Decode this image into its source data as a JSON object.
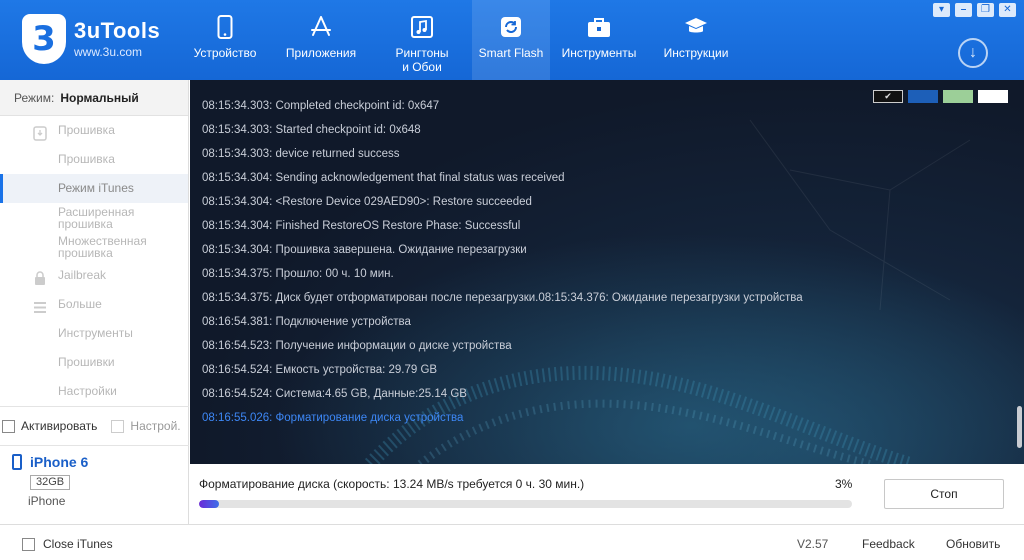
{
  "brand": {
    "logo_glyph": "3",
    "name": "3uTools",
    "url": "www.3u.com"
  },
  "nav": [
    {
      "label": "Устройство",
      "icon": "phone-icon",
      "active": false
    },
    {
      "label": "Приложения",
      "icon": "app-store-icon",
      "active": false
    },
    {
      "label": "Рингтоны\nи Обои",
      "icon": "music-icon",
      "active": false
    },
    {
      "label": "Smart Flash",
      "icon": "refresh-icon",
      "active": true
    },
    {
      "label": "Инструменты",
      "icon": "toolbox-icon",
      "active": false
    },
    {
      "label": "Инструкции",
      "icon": "graduation-cap-icon",
      "active": false
    }
  ],
  "window_controls": [
    "shirt-icon",
    "minimize-icon",
    "restore-icon",
    "close-icon"
  ],
  "sidebar": {
    "mode_label": "Режим:",
    "mode_value": "Нормальный",
    "items": [
      {
        "label": "Прошивка",
        "icon": "firmware-icon",
        "active": false
      },
      {
        "label": "Прошивка",
        "icon": "",
        "active": false
      },
      {
        "label": "Режим iTunes",
        "icon": "",
        "active": true
      },
      {
        "label": "Расширенная прошивка",
        "icon": "",
        "active": false
      },
      {
        "label": "Множественная прошивка",
        "icon": "",
        "active": false
      },
      {
        "label": "Jailbreak",
        "icon": "lock-icon",
        "active": false
      },
      {
        "label": "Больше",
        "icon": "menu-icon",
        "active": false
      },
      {
        "label": "Инструменты",
        "icon": "",
        "active": false
      },
      {
        "label": "Прошивки",
        "icon": "",
        "active": false
      },
      {
        "label": "Настройки",
        "icon": "",
        "active": false
      }
    ],
    "checks": {
      "activate": "Активировать",
      "settings": "Настрой."
    }
  },
  "device": {
    "name": "iPhone 6",
    "capacity": "32GB",
    "model": "iPhone"
  },
  "log": {
    "lines": [
      "08:15:34.303: Completed checkpoint id: 0x647",
      "08:15:34.303: Started checkpoint id: 0x648",
      "08:15:34.303: device returned success",
      "08:15:34.304: Sending acknowledgement that final status was received",
      "08:15:34.304: <Restore Device 029AED90>: Restore succeeded",
      "08:15:34.304: Finished RestoreOS Restore Phase: Successful",
      "08:15:34.304:  Прошивка завершена. Ожидание перезагрузки",
      "08:15:34.375:  Прошло: 00 ч. 10 мин.",
      "08:15:34.375:  Диск будет отформатирован после перезагрузки.08:15:34.376:  Ожидание перезагрузки устройства",
      "08:16:54.381:  Подключение устройства",
      "08:16:54.523:  Получение информации о диске устройства",
      "08:16:54.524:  Емкость устройства: 29.79 GB",
      "08:16:54.524:  Система:4.65 GB, Данные:25.14 GB",
      "08:16:55.026:  Форматирование диска устройства"
    ],
    "highlight_index": 13,
    "swatch_check": "✔",
    "swatches": [
      "#111111",
      "#1d5fb8",
      "#9ccf98",
      "#ffffff"
    ]
  },
  "progress": {
    "text": "Форматирование диска (скорость: 13.24 MB/s требуется 0 ч. 30 мин.)",
    "percent_label": "3%",
    "percent": 3,
    "stop_label": "Стоп"
  },
  "footer": {
    "close_itunes": "Close iTunes",
    "version": "V2.57",
    "feedback": "Feedback",
    "update": "Обновить"
  }
}
